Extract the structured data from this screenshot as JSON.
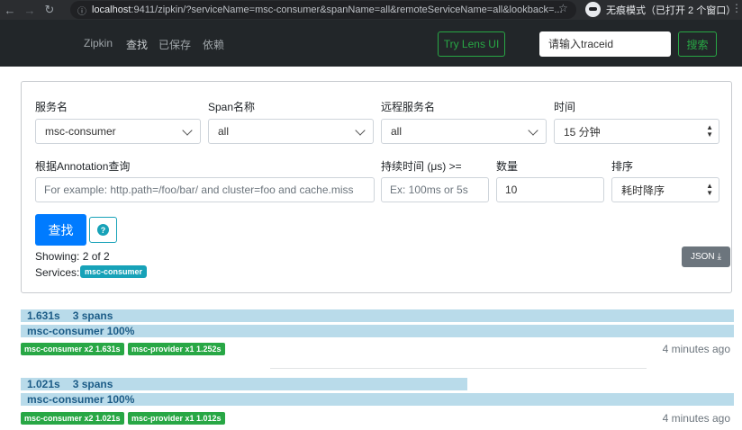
{
  "browser": {
    "url_host": "localhost",
    "url_rest": ":9411/zipkin/?serviceName=msc-consumer&spanName=all&remoteServiceName=all&lookback=...",
    "incognito_label": "无痕模式（已打开 2 个窗口）"
  },
  "header": {
    "brand": "Zipkin",
    "nav": [
      "查找",
      "已保存",
      "依赖"
    ],
    "lens_button": "Try Lens UI",
    "traceid_placeholder": "请输入traceid",
    "search_button": "搜索"
  },
  "filters": {
    "service_label": "服务名",
    "service_value": "msc-consumer",
    "span_label": "Span名称",
    "span_value": "all",
    "remote_label": "远程服务名",
    "remote_value": "all",
    "time_label": "时间",
    "time_value": "15 分钟",
    "annotation_label": "根据Annotation查询",
    "annotation_placeholder": "For example: http.path=/foo/bar/ and cluster=foo and cache.miss",
    "duration_label": "持续时间 (μs) >=",
    "duration_placeholder": "Ex: 100ms or 5s",
    "limit_label": "数量",
    "limit_value": "10",
    "sort_label": "排序",
    "sort_value": "耗时降序",
    "search_button": "查找",
    "showing": "Showing: 2 of 2",
    "services_label": "Services:",
    "services_badge": "msc-consumer",
    "json_button": "JSON"
  },
  "traces": [
    {
      "duration": "1.631s",
      "spans": "3 spans",
      "duration_fraction": 1.0,
      "service_bar": "msc-consumer 100%",
      "tags": [
        "msc-consumer x2 1.631s",
        "msc-provider x1 1.252s"
      ],
      "ago": "4 minutes ago"
    },
    {
      "duration": "1.021s",
      "spans": "3 spans",
      "duration_fraction": 0.626,
      "service_bar": "msc-consumer 100%",
      "tags": [
        "msc-consumer x2 1.021s",
        "msc-provider x1 1.012s"
      ],
      "ago": "4 minutes ago"
    }
  ],
  "colors": {
    "header_bg": "#222629",
    "accent_green": "#28a745",
    "primary_blue": "#007bff",
    "info_teal": "#17a2b8",
    "trace_bar": "#b9dbea"
  }
}
